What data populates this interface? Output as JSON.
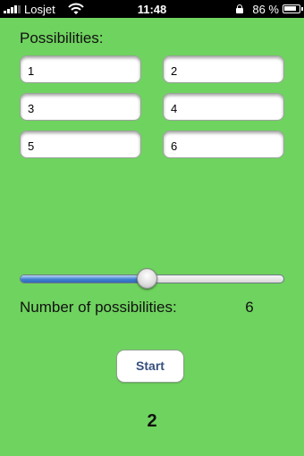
{
  "status_bar": {
    "carrier": "Losjet",
    "time": "11:48",
    "battery_percent": "86 %",
    "battery_level": 0.86,
    "icons": [
      "signal-bars-icon",
      "wifi-icon",
      "lock-icon",
      "battery-icon"
    ]
  },
  "colors": {
    "background": "#6fd35f",
    "slider_fill": "#3f7fd0",
    "button_text": "#37507f"
  },
  "heading": "Possibilities:",
  "possibilities": [
    "1",
    "2",
    "3",
    "4",
    "5",
    "6"
  ],
  "slider": {
    "fraction": 0.48
  },
  "count": {
    "label": "Number of possibilities:",
    "value": "6"
  },
  "start_button": "Start",
  "result": "2"
}
